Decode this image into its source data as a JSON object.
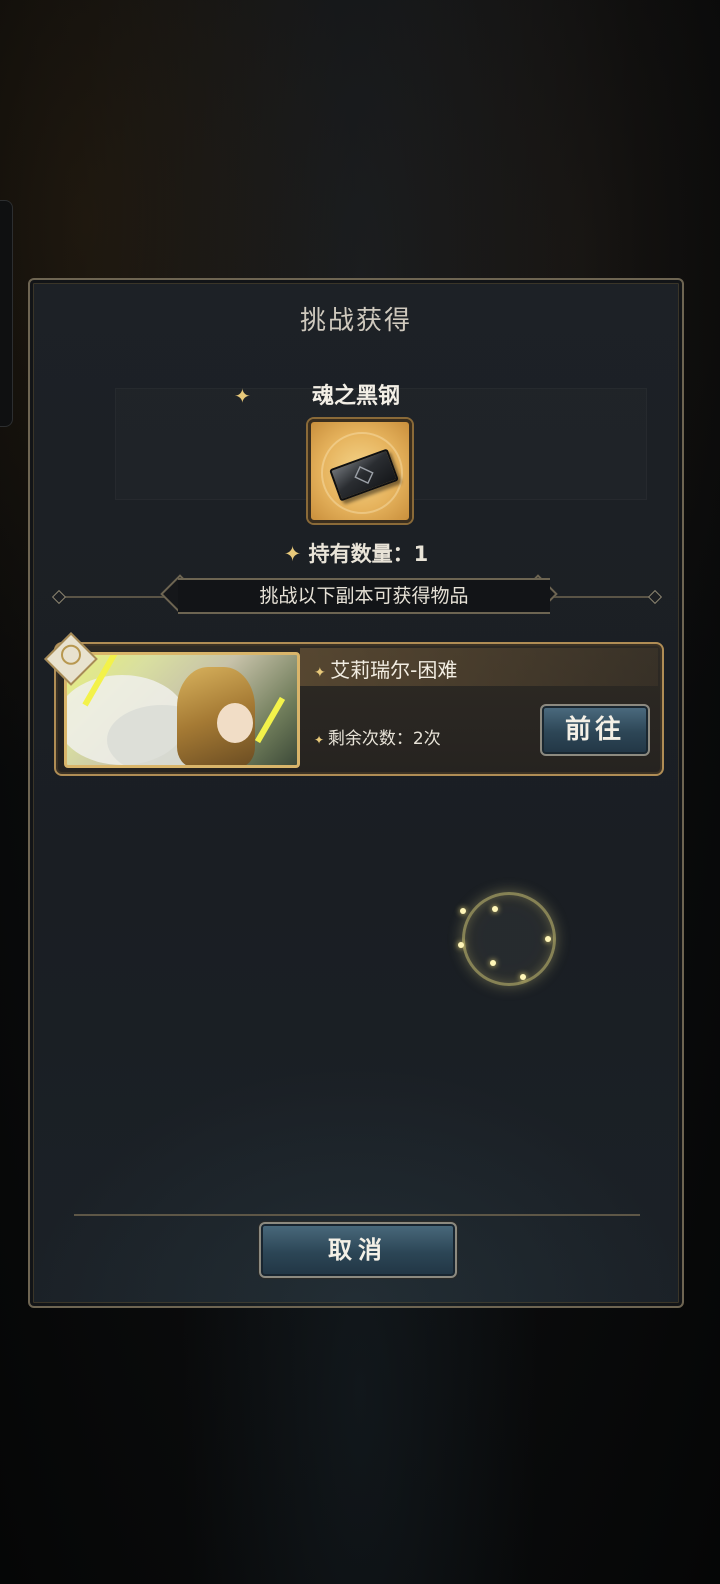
{
  "dialog": {
    "title": "挑战获得",
    "item_name": "魂之黑钢",
    "item_icon": "black-steel-ingot-icon",
    "owned_label": "持有数量：1",
    "banner_text": "挑战以下副本可获得物品"
  },
  "stages": [
    {
      "name": "艾莉瑞尔-困难",
      "remaining": "剩余次数：2次",
      "go_label": "前往",
      "portrait": "winged-golden-knight-portrait"
    }
  ],
  "footer": {
    "cancel_label": "取消"
  },
  "colors": {
    "panel_border": "#6e6552",
    "accent_gold": "#e8c97a",
    "button_blue": "#2d4656",
    "card_border": "#b08d55"
  }
}
